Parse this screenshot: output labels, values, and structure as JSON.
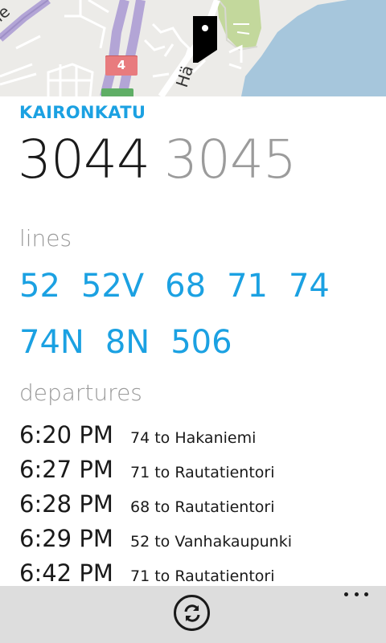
{
  "map": {
    "street_label": "Hä",
    "street_label_left": "ie",
    "route_badge": "4"
  },
  "stop": {
    "name": "KAIRONKATU",
    "code_primary": "3044",
    "code_secondary": "3045"
  },
  "lines": {
    "title": "lines",
    "items": [
      "52",
      "52V",
      "68",
      "71",
      "74",
      "74N",
      "8N",
      "506"
    ]
  },
  "departures": {
    "title": "departures",
    "rows": [
      {
        "time": "6:20 PM",
        "destination": "74 to Hakaniemi"
      },
      {
        "time": "6:27 PM",
        "destination": "71 to Rautatientori"
      },
      {
        "time": "6:28 PM",
        "destination": "68 to Rautatientori"
      },
      {
        "time": "6:29 PM",
        "destination": "52 to Vanhakaupunki"
      },
      {
        "time": "6:42 PM",
        "destination": "71 to Rautatientori"
      }
    ]
  },
  "appbar": {
    "refresh_icon": "refresh-icon",
    "more_icon": "more-icon"
  },
  "colors": {
    "accent": "#1ba1e2",
    "appbar": "#dddddd"
  }
}
